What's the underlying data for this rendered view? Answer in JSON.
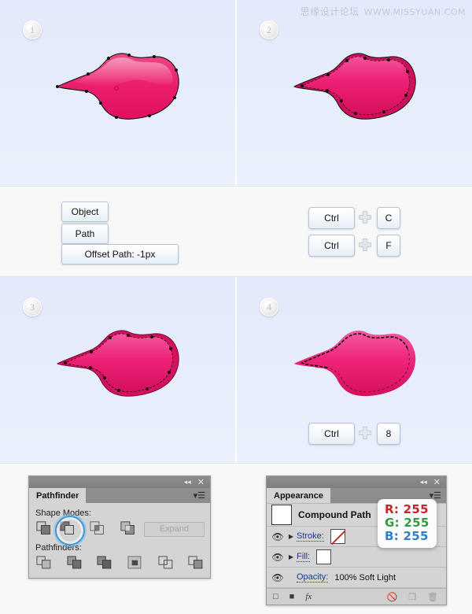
{
  "watermark": {
    "cn": "思缘设计论坛",
    "url": "WWW.MISSYUAN.COM"
  },
  "steps": [
    {
      "number": "1"
    },
    {
      "number": "2"
    },
    {
      "number": "3"
    },
    {
      "number": "4"
    }
  ],
  "menu_buttons": [
    {
      "label": "Object"
    },
    {
      "label": "Path"
    },
    {
      "label": "Offset Path: -1px"
    }
  ],
  "shortcuts": [
    {
      "modifier": "Ctrl",
      "plus": "+",
      "key": "C"
    },
    {
      "modifier": "Ctrl",
      "plus": "+",
      "key": "F"
    },
    {
      "modifier": "Ctrl",
      "plus": "+",
      "key": "8"
    }
  ],
  "pathfinder_panel": {
    "tab_label": "Pathfinder",
    "collapse_icon": "collapse-icon",
    "close_icon": "close-icon",
    "menu_icon": "panel-menu-icon",
    "shape_modes_label": "Shape Modes:",
    "pathfinders_label": "Pathfinders:",
    "expand_label": "Expand",
    "shape_modes": [
      {
        "name": "unite-icon",
        "selected": false
      },
      {
        "name": "minus-front-icon",
        "selected": true
      },
      {
        "name": "intersect-icon",
        "selected": false
      },
      {
        "name": "exclude-icon",
        "selected": false
      }
    ],
    "pathfinders": [
      {
        "name": "divide-icon"
      },
      {
        "name": "trim-icon"
      },
      {
        "name": "merge-icon"
      },
      {
        "name": "crop-icon"
      },
      {
        "name": "outline-icon"
      },
      {
        "name": "minus-back-icon"
      }
    ]
  },
  "appearance_panel": {
    "tab_label": "Appearance",
    "collapse_icon": "collapse-icon",
    "close_icon": "close-icon",
    "menu_icon": "panel-menu-icon",
    "object_title": "Compound Path",
    "rows": [
      {
        "label": "Stroke:",
        "value": "",
        "swatch": "none"
      },
      {
        "label": "Fill:",
        "value": "",
        "swatch": "white"
      }
    ],
    "opacity_label": "Opacity:",
    "opacity_value": "100% Soft Light",
    "bottom_icons": [
      {
        "name": "new-stroke-icon"
      },
      {
        "name": "new-fill-icon"
      },
      {
        "name": "fx-icon"
      },
      {
        "name": "clear-appearance-icon"
      },
      {
        "name": "duplicate-item-icon"
      },
      {
        "name": "delete-item-icon"
      }
    ]
  },
  "rgb_callout": {
    "r_label": "R: 255",
    "g_label": "G: 255",
    "b_label": "B: 255",
    "r_color": "#c8252b",
    "g_color": "#2f9c42",
    "b_color": "#2e7ec8"
  },
  "colors": {
    "canvas_bg": "#e4ecfb",
    "band_bg": "#f8f8f8",
    "blob_fill_light": "#f0337a",
    "blob_fill_dark": "#d4105c",
    "panel_bg": "#d4d4d4"
  }
}
